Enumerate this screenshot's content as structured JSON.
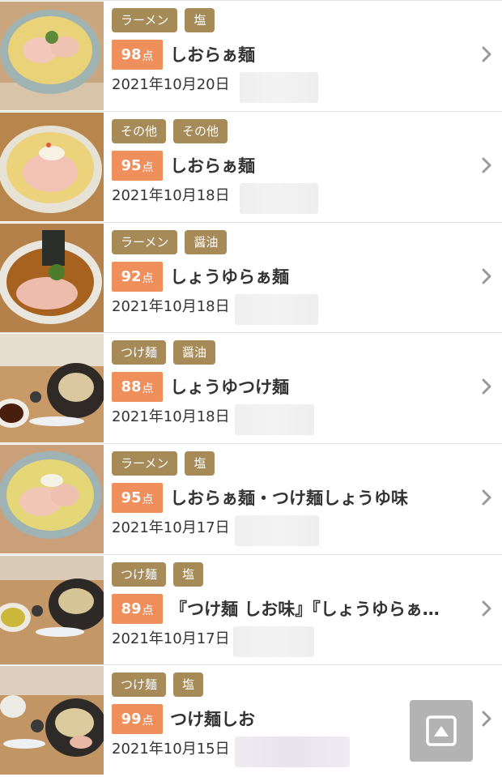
{
  "items": [
    {
      "tags": [
        "ラーメン",
        "塩"
      ],
      "score": "98",
      "unit": "点",
      "title": "しおらぁ麺",
      "date": "2021年10月20日"
    },
    {
      "tags": [
        "その他",
        "その他"
      ],
      "score": "95",
      "unit": "点",
      "title": "しおらぁ麺",
      "date": "2021年10月18日"
    },
    {
      "tags": [
        "ラーメン",
        "醤油"
      ],
      "score": "92",
      "unit": "点",
      "title": "しょうゆらぁ麺",
      "date": "2021年10月18日"
    },
    {
      "tags": [
        "つけ麺",
        "醤油"
      ],
      "score": "88",
      "unit": "点",
      "title": "しょうゆつけ麺",
      "date": "2021年10月18日"
    },
    {
      "tags": [
        "ラーメン",
        "塩"
      ],
      "score": "95",
      "unit": "点",
      "title": "しおらぁ麺・つけ麺しょうゆ味",
      "date": "2021年10月17日"
    },
    {
      "tags": [
        "つけ麺",
        "塩"
      ],
      "score": "89",
      "unit": "点",
      "title": "『つけ麺 しお味』『しょうゆらぁ…",
      "date": "2021年10月17日"
    },
    {
      "tags": [
        "つけ麺",
        "塩"
      ],
      "score": "99",
      "unit": "点",
      "title": "つけ麺しお",
      "date": "2021年10月15日"
    }
  ],
  "icons": {
    "thumbnail": "ramen-photo-icon",
    "chevron": "chevron-right-icon",
    "scroll_top": "scroll-to-top-icon"
  },
  "colors": {
    "tag_bg": "#a68a57",
    "score_bg": "#ef8f5c",
    "chevron": "#9a9a9a",
    "fab_bg": "#b3b3b3"
  }
}
